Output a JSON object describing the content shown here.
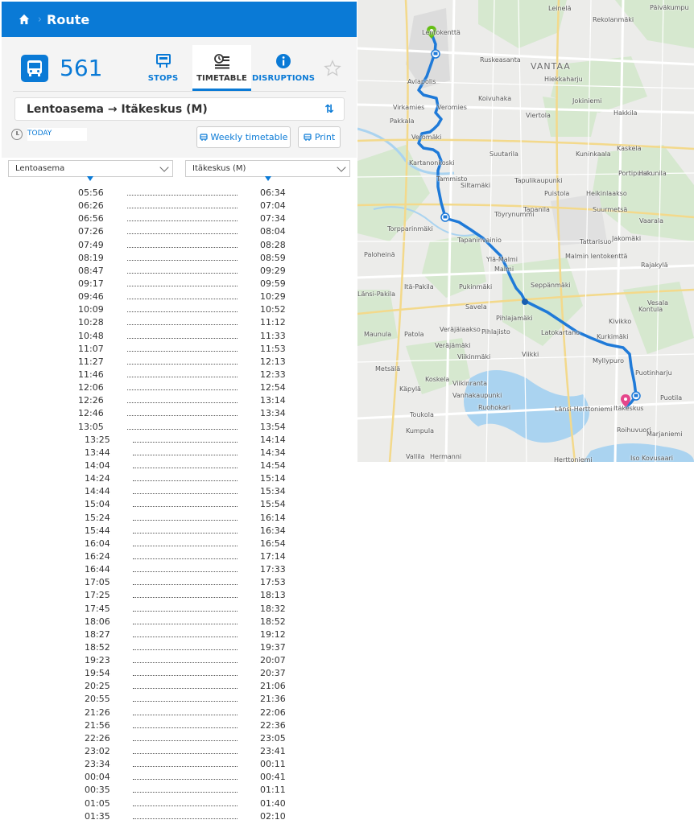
{
  "header": {
    "title": "Route"
  },
  "route": {
    "number": "561",
    "tabs": [
      {
        "label": "STOPS",
        "icon": "bus-stop-icon"
      },
      {
        "label": "TIMETABLE",
        "icon": "timetable-icon"
      },
      {
        "label": "DISRUPTIONS",
        "icon": "info-icon"
      }
    ],
    "direction": "Lentoasema → Itäkeskus (M)"
  },
  "date": {
    "value": "TODAY"
  },
  "buttons": {
    "weekly": "Weekly timetable",
    "print": "Print"
  },
  "stops": {
    "from": "Lentoasema",
    "to": "Itäkeskus (M)"
  },
  "timetable": [
    [
      "05:56",
      "06:34"
    ],
    [
      "06:26",
      "07:04"
    ],
    [
      "06:56",
      "07:34"
    ],
    [
      "07:26",
      "08:04"
    ],
    [
      "07:49",
      "08:28"
    ],
    [
      "08:19",
      "08:59"
    ],
    [
      "08:47",
      "09:29"
    ],
    [
      "09:17",
      "09:59"
    ],
    [
      "09:46",
      "10:29"
    ],
    [
      "10:09",
      "10:52"
    ],
    [
      "10:28",
      "11:12"
    ],
    [
      "10:48",
      "11:33"
    ],
    [
      "11:07",
      "11:53"
    ],
    [
      "11:27",
      "12:13"
    ],
    [
      "11:46",
      "12:33"
    ],
    [
      "12:06",
      "12:54"
    ],
    [
      "12:26",
      "13:14"
    ],
    [
      "12:46",
      "13:34"
    ],
    [
      "13:05",
      "13:54"
    ],
    [
      "13:25",
      "14:14"
    ],
    [
      "13:44",
      "14:34"
    ],
    [
      "14:04",
      "14:54"
    ],
    [
      "14:24",
      "15:14"
    ],
    [
      "14:44",
      "15:34"
    ],
    [
      "15:04",
      "15:54"
    ],
    [
      "15:24",
      "16:14"
    ],
    [
      "15:44",
      "16:34"
    ],
    [
      "16:04",
      "16:54"
    ],
    [
      "16:24",
      "17:14"
    ],
    [
      "16:44",
      "17:33"
    ],
    [
      "17:05",
      "17:53"
    ],
    [
      "17:25",
      "18:13"
    ],
    [
      "17:45",
      "18:32"
    ],
    [
      "18:06",
      "18:52"
    ],
    [
      "18:27",
      "19:12"
    ],
    [
      "18:52",
      "19:37"
    ],
    [
      "19:23",
      "20:07"
    ],
    [
      "19:54",
      "20:37"
    ],
    [
      "20:25",
      "21:06"
    ],
    [
      "20:55",
      "21:36"
    ],
    [
      "21:26",
      "22:06"
    ],
    [
      "21:56",
      "22:36"
    ],
    [
      "22:26",
      "23:05"
    ],
    [
      "23:02",
      "23:41"
    ],
    [
      "23:34",
      "00:11"
    ],
    [
      "00:04",
      "00:41"
    ],
    [
      "00:35",
      "01:11"
    ],
    [
      "01:05",
      "01:40"
    ],
    [
      "01:35",
      "02:10"
    ]
  ],
  "map": {
    "places": [
      {
        "name": "Leinelä"
      },
      {
        "name": "Rekolanmäki"
      },
      {
        "name": "Päiväkumpu"
      },
      {
        "name": "Lentokenttä"
      },
      {
        "name": "Ruskeasanta"
      },
      {
        "name": "VANTAA"
      },
      {
        "name": "Hiekkaharju"
      },
      {
        "name": "Aviapolis"
      },
      {
        "name": "Koivuhaka"
      },
      {
        "name": "Jokiniemi"
      },
      {
        "name": "Virkamies"
      },
      {
        "name": "Veromies"
      },
      {
        "name": "Viertola"
      },
      {
        "name": "Hakkila"
      },
      {
        "name": "Pakkala"
      },
      {
        "name": "Kaskela"
      },
      {
        "name": "Veromäki"
      },
      {
        "name": "Suutarila"
      },
      {
        "name": "Kuninkaala"
      },
      {
        "name": "Kartanonkoski"
      },
      {
        "name": "Portipuisto"
      },
      {
        "name": "Tammisto"
      },
      {
        "name": "Tapulikaupunki"
      },
      {
        "name": "Siltamäki"
      },
      {
        "name": "Puistola"
      },
      {
        "name": "Heikinlaakso"
      },
      {
        "name": "Hakunila"
      },
      {
        "name": "Tapanila"
      },
      {
        "name": "Suurmetsä"
      },
      {
        "name": "Töyrynummi"
      },
      {
        "name": "Vaarala"
      },
      {
        "name": "Torpparinmäki"
      },
      {
        "name": "Tattarisuo"
      },
      {
        "name": "Jakomäki"
      },
      {
        "name": "Tapaninvainio"
      },
      {
        "name": "Malmin lentokenttä"
      },
      {
        "name": "Paloheinä"
      },
      {
        "name": "Rajakylä"
      },
      {
        "name": "Ylä-Malmi"
      },
      {
        "name": "Malmi"
      },
      {
        "name": "Itä-Pakila"
      },
      {
        "name": "Pukinmäki"
      },
      {
        "name": "Seppänmäki"
      },
      {
        "name": "Länsi-Pakila"
      },
      {
        "name": "Kontula"
      },
      {
        "name": "Vesala"
      },
      {
        "name": "Savela"
      },
      {
        "name": "Pihlajamäki"
      },
      {
        "name": "Kivikko"
      },
      {
        "name": "Maunula"
      },
      {
        "name": "Patola"
      },
      {
        "name": "Veräjälaakso"
      },
      {
        "name": "Pihlajisto"
      },
      {
        "name": "Latokartano"
      },
      {
        "name": "Kurkimäki"
      },
      {
        "name": "Veräjämäki"
      },
      {
        "name": "Viikinmäki"
      },
      {
        "name": "Viikki"
      },
      {
        "name": "Myllypuro"
      },
      {
        "name": "Metsälä"
      },
      {
        "name": "Koskela"
      },
      {
        "name": "Puotinharju"
      },
      {
        "name": "Käpylä"
      },
      {
        "name": "Viikinranta"
      },
      {
        "name": "Vanhakaupunki"
      },
      {
        "name": "Itäkeskus"
      },
      {
        "name": "Puotila"
      },
      {
        "name": "Toukola"
      },
      {
        "name": "Länsi-Herttoniemi"
      },
      {
        "name": "Kumpula"
      },
      {
        "name": "Roihuvuori"
      },
      {
        "name": "Marjaniemi"
      },
      {
        "name": "Vallila"
      },
      {
        "name": "Hermanni"
      },
      {
        "name": "Herttoniemi"
      },
      {
        "name": "Iso Kovusaari"
      },
      {
        "name": "Ruohokari"
      }
    ]
  },
  "colors": {
    "accent": "#0a7ad6",
    "route_line": "#1f7ad8",
    "header": "#0a7ad6"
  }
}
